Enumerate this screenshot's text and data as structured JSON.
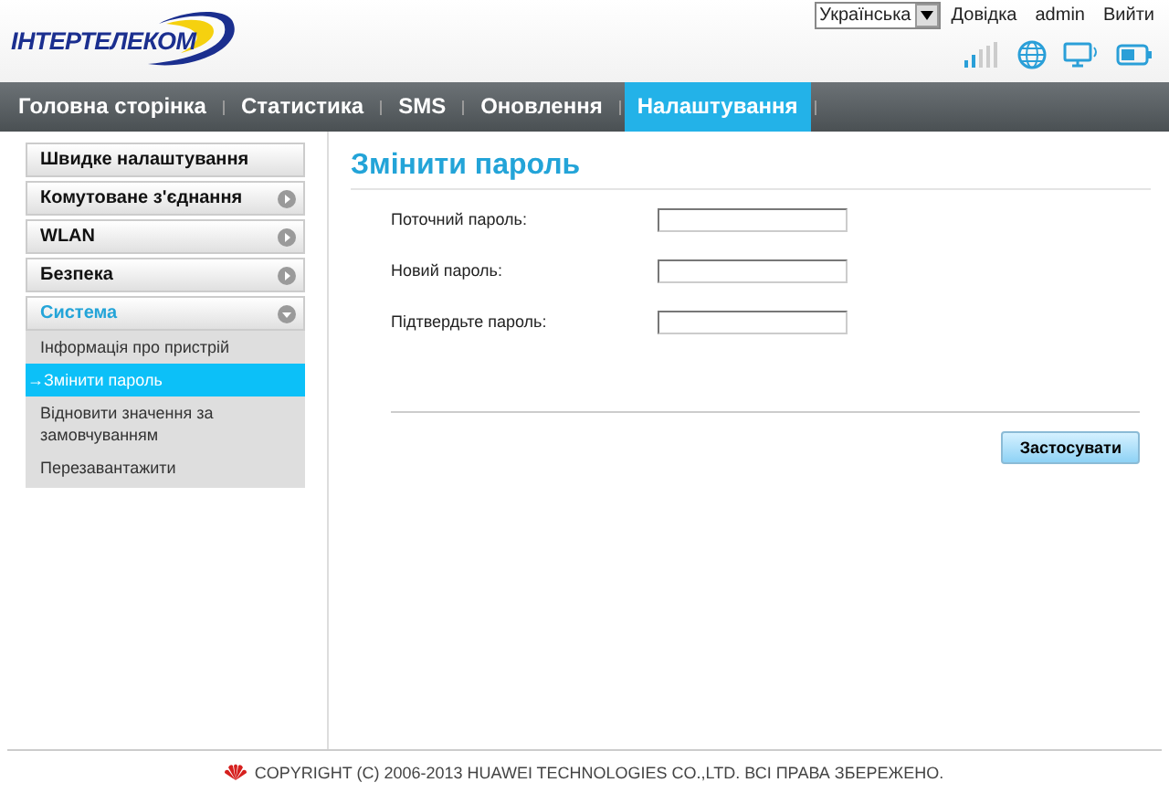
{
  "header": {
    "logo": "ІНТЕРТЕЛЕКОМ",
    "language": "Українська",
    "links": [
      "Довідка",
      "admin",
      "Вийти"
    ]
  },
  "nav": [
    {
      "label": "Головна сторінка",
      "selected": false
    },
    {
      "label": "Статистика",
      "selected": false
    },
    {
      "label": "SMS",
      "selected": false
    },
    {
      "label": "Оновлення",
      "selected": false
    },
    {
      "label": "Налаштування",
      "selected": true
    }
  ],
  "sidebar": {
    "items": [
      {
        "label": "Швидке налаштування",
        "kind": "link",
        "expanded": false
      },
      {
        "label": "Комутоване з'єднання",
        "kind": "group",
        "expanded": false
      },
      {
        "label": "WLAN",
        "kind": "group",
        "expanded": false
      },
      {
        "label": "Безпека",
        "kind": "group",
        "expanded": false
      },
      {
        "label": "Система",
        "kind": "group",
        "expanded": true,
        "children": [
          {
            "label": "Інформація про пристрій",
            "selected": false
          },
          {
            "label": "→Змінити пароль",
            "selected": true
          },
          {
            "label": "Відновити значення за замовчуванням",
            "selected": false
          },
          {
            "label": "Перезавантажити",
            "selected": false
          }
        ]
      }
    ]
  },
  "page": {
    "title": "Змінити пароль",
    "fields": [
      {
        "label": "Поточний пароль:"
      },
      {
        "label": "Новий пароль:"
      },
      {
        "label": "Підтвердьте пароль:"
      }
    ],
    "apply_button": "Застосувати"
  },
  "footer": {
    "copyright": "COPYRIGHT (C) 2006-2013 HUAWEI TECHNOLOGIES CO.,LTD. ВСІ ПРАВА ЗБЕРЕЖЕНО."
  }
}
